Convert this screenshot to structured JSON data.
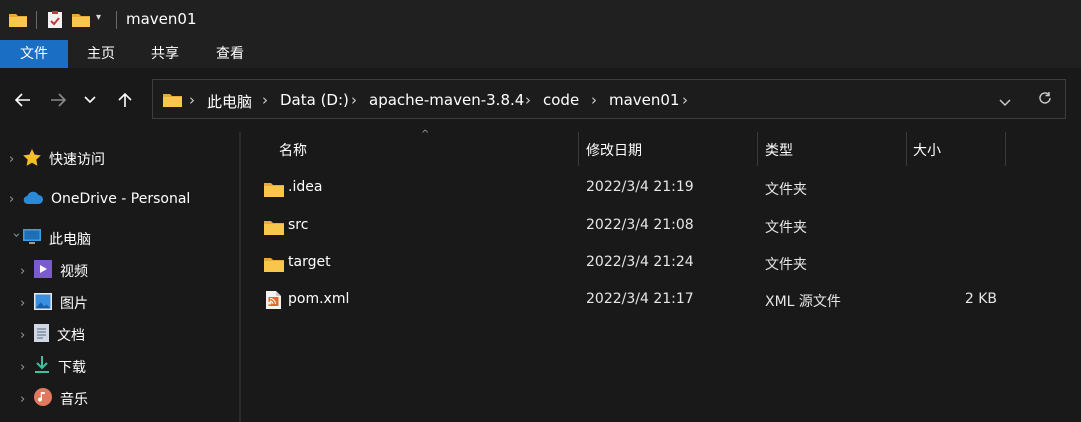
{
  "window": {
    "title": "maven01"
  },
  "ribbon": {
    "tabs": [
      {
        "label": "文件"
      },
      {
        "label": "主页"
      },
      {
        "label": "共享"
      },
      {
        "label": "查看"
      }
    ]
  },
  "address": {
    "crumbs": [
      "此电脑",
      "Data (D:)",
      "apache-maven-3.8.4",
      "code",
      "maven01"
    ],
    "separator": "›"
  },
  "sidebar": {
    "items": [
      {
        "label": "快速访问",
        "icon": "star-icon"
      },
      {
        "label": "OneDrive - Personal",
        "icon": "cloud-icon"
      },
      {
        "label": "此电脑",
        "icon": "computer-icon"
      },
      {
        "label": "视频",
        "icon": "video-icon"
      },
      {
        "label": "图片",
        "icon": "picture-icon"
      },
      {
        "label": "文档",
        "icon": "document-icon"
      },
      {
        "label": "下载",
        "icon": "download-icon"
      },
      {
        "label": "音乐",
        "icon": "music-icon"
      }
    ]
  },
  "columns": {
    "name": "名称",
    "date": "修改日期",
    "type": "类型",
    "size": "大小"
  },
  "files": [
    {
      "name": ".idea",
      "date": "2022/3/4 21:19",
      "type": "文件夹",
      "size": "",
      "icon": "folder-icon"
    },
    {
      "name": "src",
      "date": "2022/3/4 21:08",
      "type": "文件夹",
      "size": "",
      "icon": "folder-icon"
    },
    {
      "name": "target",
      "date": "2022/3/4 21:24",
      "type": "文件夹",
      "size": "",
      "icon": "folder-icon"
    },
    {
      "name": "pom.xml",
      "date": "2022/3/4 21:17",
      "type": "XML 源文件",
      "size": "2 KB",
      "icon": "xml-file-icon"
    }
  ],
  "colors": {
    "accent": "#1a6fc4",
    "background": "#191919",
    "folder": "#f8c64a"
  }
}
